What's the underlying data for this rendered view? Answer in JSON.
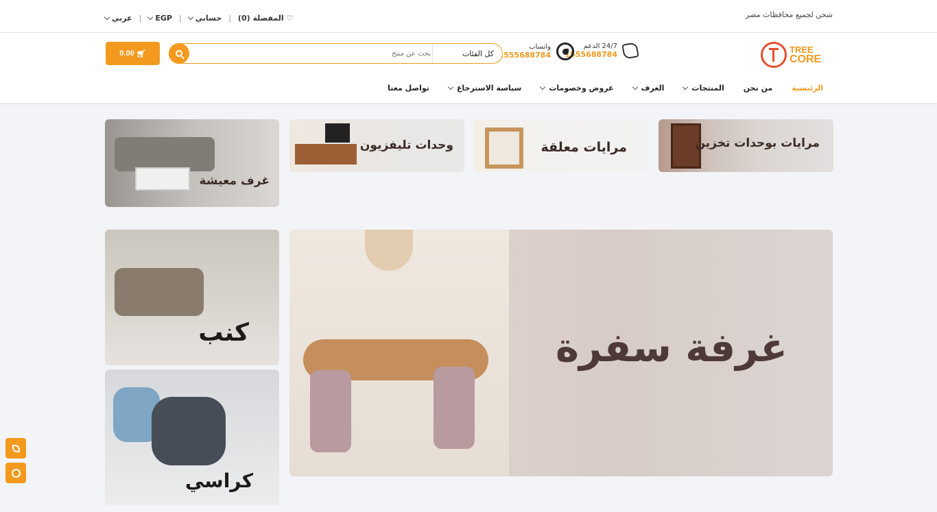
{
  "topbar": {
    "shipping_note": "شحن لجميع محافظات مصر",
    "wishlist_label": "المفضلة (0)",
    "account_label": "حسابي",
    "currency_label": "EGP",
    "language_label": "عربي"
  },
  "header": {
    "logo": {
      "line1": "TREE",
      "line2": "CORE"
    },
    "support": {
      "label": "24/7 الدعم",
      "number": "1555688784"
    },
    "whatsapp": {
      "label": "واتساب",
      "number": "1555688784"
    },
    "search": {
      "category": "كل الفئات",
      "placeholder": "بحث عن منتج"
    },
    "cart": {
      "amount": "0.00"
    }
  },
  "nav": {
    "items": [
      {
        "label": "الرئيسية",
        "active": true
      },
      {
        "label": "من نحن"
      },
      {
        "label": "المنتجات",
        "dropdown": true
      },
      {
        "label": "الغرف",
        "dropdown": true
      },
      {
        "label": "عروض وخصومات",
        "dropdown": true
      },
      {
        "label": "سياسة الاسترجاع",
        "dropdown": true
      },
      {
        "label": "تواصل معنا"
      }
    ]
  },
  "tiles": {
    "storage_mirrors": "مرايات بوحدات تخزين",
    "hanging_mirrors": "مرايات معلقة",
    "tv_units": "وحدات تليفزيون",
    "living_rooms": "غرف معيشة",
    "dining_room": "غرفة سفرة",
    "sofas": "كنب",
    "chairs": "كراسي"
  },
  "colors": {
    "accent": "#f39a1e",
    "logo_red": "#e74c2c"
  }
}
